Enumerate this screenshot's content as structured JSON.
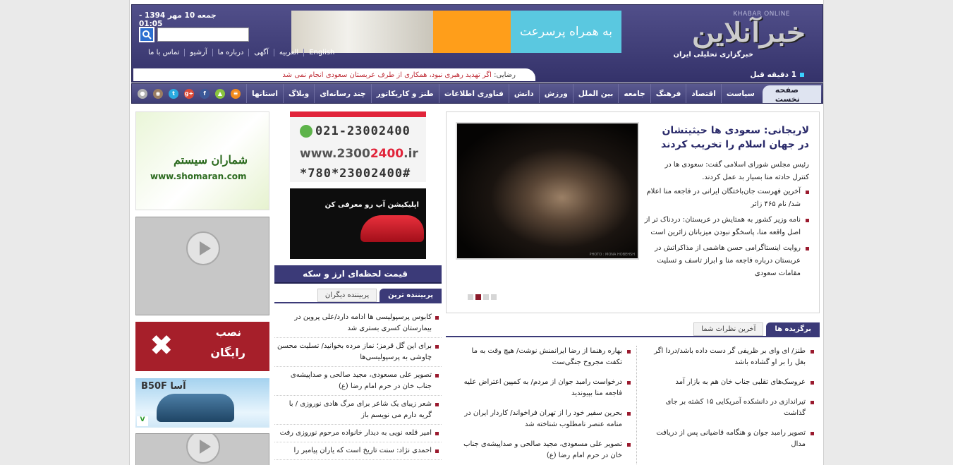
{
  "header": {
    "logo_en_bold": "KHABAR",
    "logo_en_light": " ONLINE",
    "logo_fa": "خبرآنلاین",
    "tagline": "خبرگزاری تحلیلی ایران",
    "date": "جمعه 10 مهر 1394 - 01:05",
    "search_placeholder": "",
    "toplinks": [
      "English",
      "العربیه",
      "آگهی",
      "درباره ما",
      "آرشیو",
      "تماس با ما"
    ],
    "banner_text": "به همراه پرسرعت",
    "since_label": "1 دقیقه قبل",
    "ticker_label": "رضایی:",
    "ticker_text": " اگر تهدید رهبری نبود، همکاری از طرف عربستان سعودی انجام نمی شد"
  },
  "nav": {
    "home": "صفحه نخست",
    "items": [
      "سیاست",
      "اقتصاد",
      "فرهنگ",
      "جامعه",
      "بین الملل",
      "ورزش",
      "دانش",
      "فناوری اطلاعات",
      "طنز و کاریکاتور",
      "چند رسانه‌ای",
      "وبلاگ",
      "استانها"
    ],
    "social": [
      {
        "name": "rss-icon",
        "color": "#f28a1b",
        "glyph": "≡"
      },
      {
        "name": "android-icon",
        "color": "#8ac43f",
        "glyph": "▲"
      },
      {
        "name": "facebook-icon",
        "color": "#3b5998",
        "glyph": "f"
      },
      {
        "name": "google-plus-icon",
        "color": "#dc4a38",
        "glyph": "g+"
      },
      {
        "name": "twitter-icon",
        "color": "#2aa9e0",
        "glyph": "t"
      },
      {
        "name": "instagram-icon",
        "color": "#9a7d62",
        "glyph": "◉"
      },
      {
        "name": "aparat-icon",
        "color": "#b0b0b0",
        "glyph": "●"
      }
    ]
  },
  "feature": {
    "title": "لاریجانی: سعودی ها حیثیتشان در جهان اسلام را تخریب کردند",
    "lead": "رئیس مجلس شورای اسلامی گفت: سعودی ها در کنترل حادثه منا بسیار بد عمل کردند.",
    "items": [
      "آخرین فهرست جان‌باختگان ایرانی در فاجعه منا اعلام شد/ نام ۴۶۵ زائر",
      "نامه وزیر کشور به همتایش در عربستان: دردناک تر از اصل واقعه منا، پاسخگو نبودن میزبانان زائرین است",
      "روایت اینستاگرامی حسن هاشمی از مذاکراتش در عربستان درباره فاجعه منا و ابراز تاسف و تسلیت مقامات سعودی"
    ],
    "photo_credit": "PHOTO : MONA HOBEHSH"
  },
  "rightcol": {
    "tab_active": "برگزیده ها",
    "tab_other": "آخرین نظرات شما",
    "col1": [
      "طنز/ ای وای بر ظریفی گر دست داده باشد/دردا اگر بغل را بر او گشاده باشد",
      "عروسک‌های تقلبی جناب خان هم به بازار آمد",
      "تیراندازی در دانشکده آمریکایی ۱۵ کشته بر جای گذاشت",
      "تصویر رامبد جوان و هنگامه قاضیانی پس از دریافت مدال"
    ],
    "col2": [
      "بهاره رهنما از رضا ایرانمنش نوشت/ هیچ وقت به ما تکفت مجروح جنگی‌ست",
      "درخواست رامبد جوان از مردم/ به کمپین اعتراض علیه فاجعه منا بپیوندید",
      "بحرین سفیر خود را از تهران فراخواند/ کاردار ایران در منامه عنصر نامطلوب شناخته شد",
      "تصویر علی مسعودی، مجید صالحی و صداپیشه‌ی جناب خان در حرم امام رضا (ع)"
    ]
  },
  "midcol": {
    "ad_phone_line1": "021-23002400",
    "ad_phone_line2_pre": "www.2300",
    "ad_phone_line2_red": "2400",
    "ad_phone_line2_post": ".ir",
    "ad_phone_line3": "*780*23002400#",
    "ad_car_text": "اپلیکیشن آپ رو معرفی کن",
    "rate_title": "قیمت لحظه‌ای ارز و سکه",
    "tab_active": "پربیننده ترین",
    "tab_other": "پربیننده دیگران",
    "list": [
      "کابوس پرسپولیسی ها ادامه دارد/علی پروین در بیمارستان کسری بستری شد",
      "برای این گل قرمز؛ نماز مرده بخوانید/ تسلیت محسن چاوشی به پرسپولیسی‌ها",
      "تصویر علی مسعودی، مجید صالحی و صداپیشه‌ی جناب خان در حرم امام رضا (ع)",
      "شعر زیبای یک شاعر برای مرگ هادی نوروزی / با گریه دارم می نویسم باز",
      "امیر قلعه نویی به دیدار خانواده مرحوم نوروزی رفت",
      "احمدی نژاد: سنت تاریخ است که یاران پیامبر را"
    ]
  },
  "leftcol": {
    "shomaran_fa": "شماران سیستم",
    "shomaran_en": "www.shomaran.com",
    "install_line1": "نصب",
    "install_line2": "رایگان",
    "asa_brand": "B50F آسا",
    "asa_badge": "V"
  }
}
